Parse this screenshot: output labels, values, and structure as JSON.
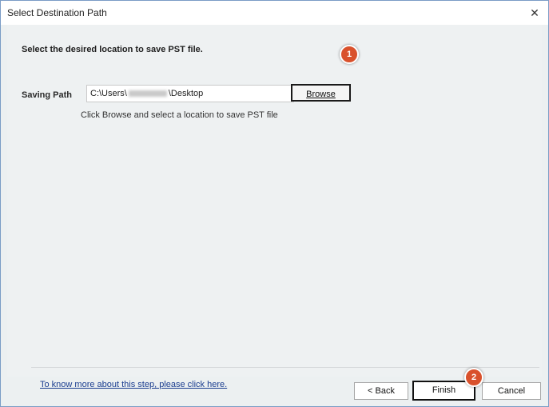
{
  "window": {
    "title": "Select Destination Path"
  },
  "main": {
    "instruction": "Select the desired location to save PST file.",
    "saving_path_label": "Saving Path",
    "path_prefix": "C:\\Users\\",
    "path_suffix": "\\Desktop",
    "browse_label": "Browse",
    "hint": "Click Browse and select a location to save PST file"
  },
  "annotations": {
    "badge_1": "1",
    "badge_2": "2"
  },
  "footer": {
    "help_link": "To know more about this step, please click here.",
    "back_label": "< Back",
    "finish_label": "Finish",
    "cancel_label": "Cancel"
  },
  "colors": {
    "accent_badge": "#d9512c",
    "link": "#1a3d8f",
    "content_bg": "#eef1f2"
  }
}
